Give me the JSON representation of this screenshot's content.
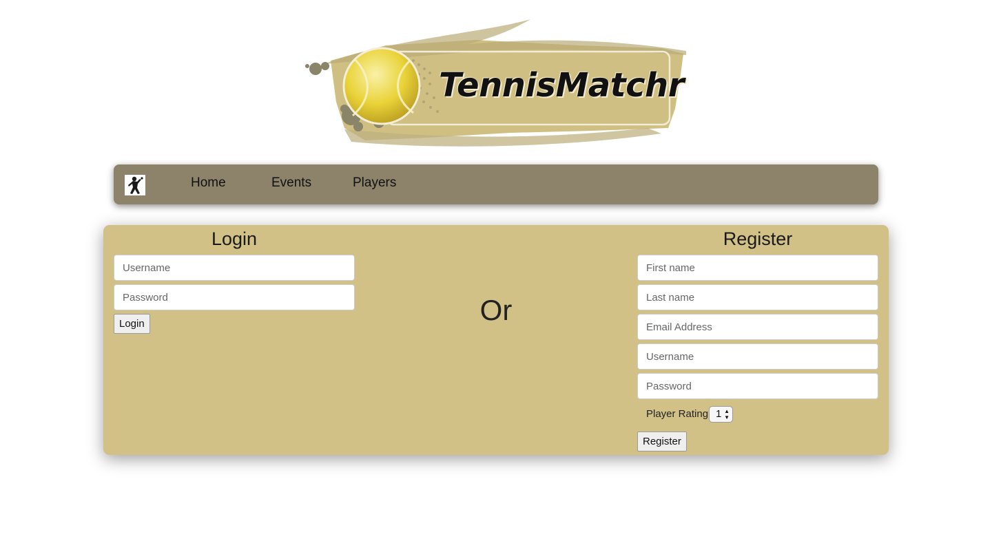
{
  "logo": {
    "text": "TennisMatchr",
    "colors": {
      "ball": "#e8d23a",
      "brush": "#cfbf82",
      "splatter": "#8a8468"
    }
  },
  "navbar": {
    "brand_icon": "tennis-player-silhouette-icon",
    "items": [
      {
        "label": "Home"
      },
      {
        "label": "Events"
      },
      {
        "label": "Players"
      }
    ],
    "background": "#8c836a"
  },
  "panel": {
    "background": "#d1c186"
  },
  "login": {
    "title": "Login",
    "username_placeholder": "Username",
    "password_placeholder": "Password",
    "button_label": "Login"
  },
  "divider": {
    "text": "Or"
  },
  "register": {
    "title": "Register",
    "first_name_placeholder": "First name",
    "last_name_placeholder": "Last name",
    "email_placeholder": "Email Address",
    "username_placeholder": "Username",
    "password_placeholder": "Password",
    "rating_label": "Player Rating:",
    "rating_value": "1",
    "button_label": "Register"
  }
}
